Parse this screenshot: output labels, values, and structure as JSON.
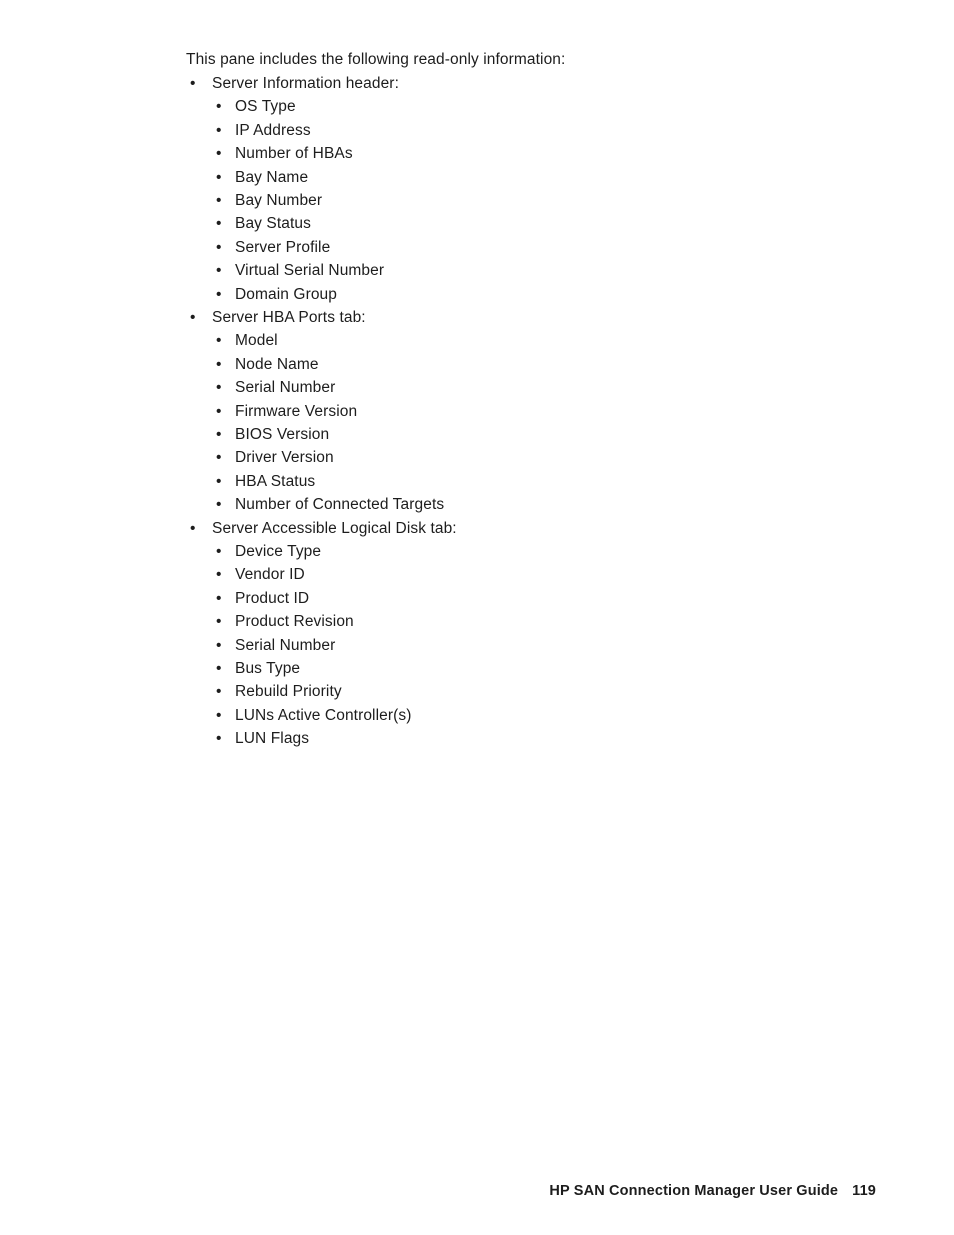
{
  "document": {
    "intro_paragraph": "This pane includes the following read-only information:",
    "bullet_glyph": "•"
  },
  "sections": [
    {
      "label": "Server Information header:",
      "items": [
        "OS Type",
        "IP Address",
        "Number of HBAs",
        "Bay Name",
        "Bay Number",
        "Bay Status",
        "Server Profile",
        "Virtual Serial Number",
        "Domain Group"
      ]
    },
    {
      "label": "Server HBA Ports tab:",
      "items": [
        "Model",
        "Node Name",
        "Serial Number",
        "Firmware Version",
        "BIOS Version",
        "Driver Version",
        "HBA Status",
        "Number of Connected Targets"
      ]
    },
    {
      "label": "Server Accessible Logical Disk tab:",
      "items": [
        "Device Type",
        "Vendor ID",
        "Product ID",
        "Product Revision",
        "Serial Number",
        "Bus Type",
        "Rebuild Priority",
        "LUNs Active Controller(s)",
        "LUN Flags"
      ]
    }
  ],
  "footer": {
    "title": "HP SAN Connection Manager User Guide",
    "page_number": "119"
  },
  "colors": {
    "page_background": "#ffffff",
    "body_text": "#1d1d1d"
  }
}
